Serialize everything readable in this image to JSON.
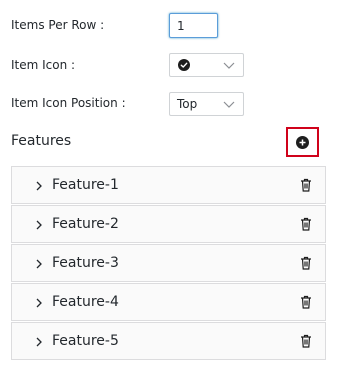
{
  "settings": {
    "items_per_row": {
      "label": "Items Per Row :",
      "value": "1"
    },
    "item_icon": {
      "label": "Item Icon :",
      "selected_icon": "check-circle-icon"
    },
    "item_icon_position": {
      "label": "Item Icon Position :",
      "selected": "Top"
    }
  },
  "features": {
    "title": "Features",
    "add_icon": "plus-circle-icon",
    "items": [
      {
        "label": "Feature-1"
      },
      {
        "label": "Feature-2"
      },
      {
        "label": "Feature-3"
      },
      {
        "label": "Feature-4"
      },
      {
        "label": "Feature-5"
      }
    ]
  },
  "colors": {
    "highlight_border": "#d0021b",
    "focus_border": "#5b9dd9"
  }
}
